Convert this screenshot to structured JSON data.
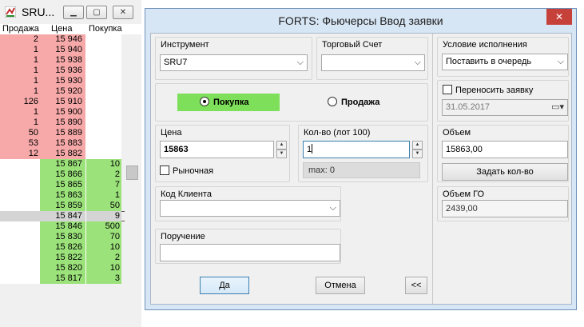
{
  "orderbook": {
    "title": "SRU...",
    "headers": {
      "sell": "Продажа",
      "price": "Цена",
      "buy": "Покупка"
    },
    "asks": [
      {
        "sell": "2",
        "price": "15 946"
      },
      {
        "sell": "1",
        "price": "15 940"
      },
      {
        "sell": "1",
        "price": "15 938"
      },
      {
        "sell": "1",
        "price": "15 936"
      },
      {
        "sell": "1",
        "price": "15 930"
      },
      {
        "sell": "1",
        "price": "15 920"
      },
      {
        "sell": "126",
        "price": "15 910"
      },
      {
        "sell": "1",
        "price": "15 900"
      },
      {
        "sell": "1",
        "price": "15 890"
      },
      {
        "sell": "50",
        "price": "15 889"
      },
      {
        "sell": "53",
        "price": "15 883"
      },
      {
        "sell": "12",
        "price": "15 882"
      }
    ],
    "bids": [
      {
        "price": "15 867",
        "buy": "10"
      },
      {
        "price": "15 866",
        "buy": "2"
      },
      {
        "price": "15 865",
        "buy": "7"
      },
      {
        "price": "15 863",
        "buy": "1"
      },
      {
        "price": "15 859",
        "buy": "50"
      },
      {
        "price": "15 847",
        "buy": "9",
        "current": true
      },
      {
        "price": "15 846",
        "buy": "500"
      },
      {
        "price": "15 830",
        "buy": "70"
      },
      {
        "price": "15 826",
        "buy": "10"
      },
      {
        "price": "15 822",
        "buy": "2"
      },
      {
        "price": "15 820",
        "buy": "10"
      },
      {
        "price": "15 817",
        "buy": "3"
      }
    ],
    "colors": {
      "ask": "#f7a9a9",
      "bid": "#9be27a"
    }
  },
  "dialog": {
    "title": "FORTS: Фьючерсы Ввод заявки",
    "close_icon": "✕",
    "instrument": {
      "label": "Инструмент",
      "value": "SRU7"
    },
    "account": {
      "label": "Торговый Счет",
      "value": ""
    },
    "condition": {
      "label": "Условие исполнения",
      "value": "Поставить в очередь"
    },
    "buy_label": "Покупка",
    "sell_label": "Продажа",
    "side_selected": "buy",
    "transfer": {
      "label": "Переносить заявку",
      "date": "31.05.2017"
    },
    "price": {
      "label": "Цена",
      "value": "15863"
    },
    "quantity": {
      "label": "Кол-во (лот 100)",
      "value": "1",
      "max": "max: 0"
    },
    "volume": {
      "label": "Объем",
      "value": "15863,00"
    },
    "set_qty_label": "Задать кол-во",
    "market_label": "Рыночная",
    "client": {
      "label": "Код Клиента",
      "value": ""
    },
    "go_volume": {
      "label": "Объем ГО",
      "value": "2439,00"
    },
    "instruction": {
      "label": "Поручение",
      "value": ""
    },
    "ok_label": "Да",
    "cancel_label": "Отмена",
    "collapse_label": "<<",
    "buy_color": "#7ee05a"
  }
}
